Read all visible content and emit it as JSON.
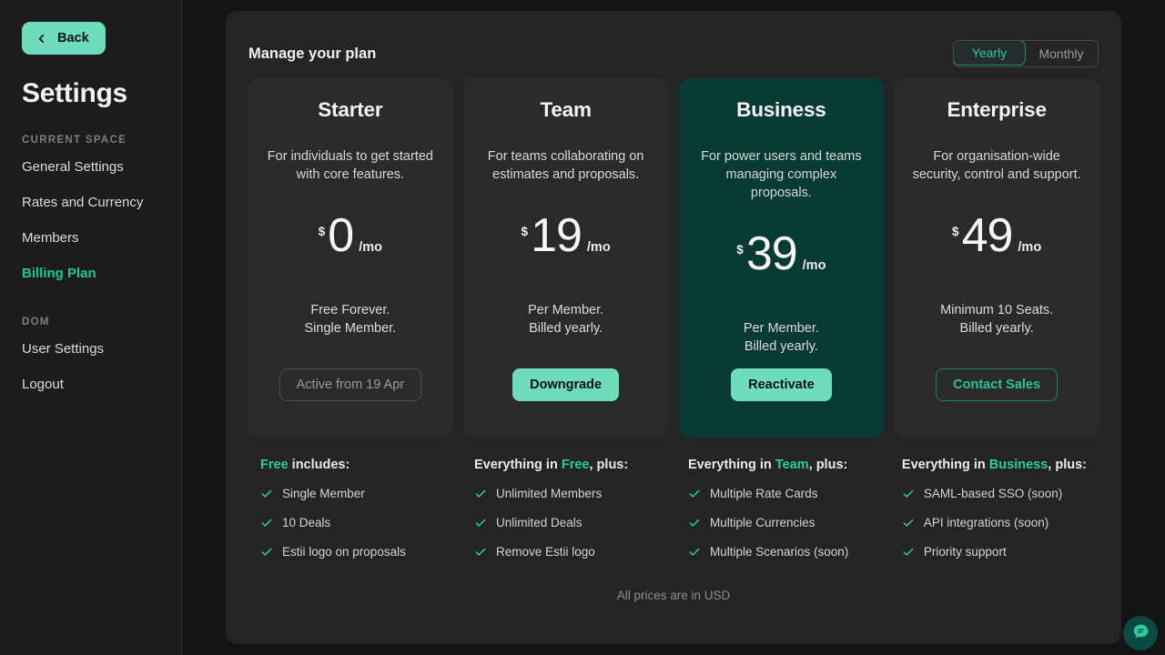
{
  "sidebar": {
    "back_label": "Back",
    "back_icon": "chevron-left-icon",
    "title": "Settings",
    "groups": [
      {
        "label": "CURRENT SPACE",
        "items": [
          {
            "label": "General Settings",
            "active": false
          },
          {
            "label": "Rates and Currency",
            "active": false
          },
          {
            "label": "Members",
            "active": false
          },
          {
            "label": "Billing Plan",
            "active": true
          }
        ]
      },
      {
        "label": "DOM",
        "items": [
          {
            "label": "User Settings",
            "active": false
          },
          {
            "label": "Logout",
            "active": false
          }
        ]
      }
    ]
  },
  "panel": {
    "heading": "Manage your plan",
    "billing_toggle": {
      "options": [
        "Yearly",
        "Monthly"
      ],
      "selected": "Yearly"
    },
    "footer_note": "All prices are in USD"
  },
  "plans": [
    {
      "name": "Starter",
      "description": "For individuals to get started with core features.",
      "currency": "$",
      "amount": "0",
      "period": "/mo",
      "terms": "Free Forever.\nSingle Member.",
      "cta_label": "Active from 19 Apr",
      "cta_style": "disabled",
      "featured": false
    },
    {
      "name": "Team",
      "description": "For teams collaborating on estimates and proposals.",
      "currency": "$",
      "amount": "19",
      "period": "/mo",
      "terms": "Per Member.\nBilled yearly.",
      "cta_label": "Downgrade",
      "cta_style": "solid",
      "featured": false
    },
    {
      "name": "Business",
      "description": "For power users and teams managing complex proposals.",
      "currency": "$",
      "amount": "39",
      "period": "/mo",
      "terms": "Per Member.\nBilled yearly.",
      "cta_label": "Reactivate",
      "cta_style": "solid",
      "featured": true
    },
    {
      "name": "Enterprise",
      "description": "For organisation-wide security, control and support.",
      "currency": "$",
      "amount": "49",
      "period": "/mo",
      "terms": "Minimum 10 Seats.\nBilled yearly.",
      "cta_label": "Contact Sales",
      "cta_style": "outline-accent",
      "featured": false
    }
  ],
  "feature_columns": [
    {
      "title_pre": "",
      "title_hl": "Free",
      "title_post": " includes:",
      "items": [
        "Single Member",
        "10 Deals",
        "Estii logo on proposals"
      ]
    },
    {
      "title_pre": "Everything in ",
      "title_hl": "Free",
      "title_post": ", plus:",
      "items": [
        "Unlimited Members",
        "Unlimited Deals",
        "Remove Estii logo"
      ]
    },
    {
      "title_pre": "Everything in ",
      "title_hl": "Team",
      "title_post": ", plus:",
      "items": [
        "Multiple Rate Cards",
        "Multiple Currencies",
        "Multiple Scenarios (soon)"
      ]
    },
    {
      "title_pre": "Everything in ",
      "title_hl": "Business",
      "title_post": ", plus:",
      "items": [
        "SAML-based SSO (soon)",
        "API integrations (soon)",
        "Priority support"
      ]
    }
  ],
  "chat": {
    "icon": "chat-bubble-icon"
  },
  "colors": {
    "accent_mint": "#6fddbd",
    "accent_teal": "#2ccb9f",
    "featured_card_bg": "#073a33",
    "card_bg": "#2a2a2a",
    "panel_bg": "#242424",
    "page_bg": "#131313",
    "sidebar_bg": "#1c1c1c"
  }
}
